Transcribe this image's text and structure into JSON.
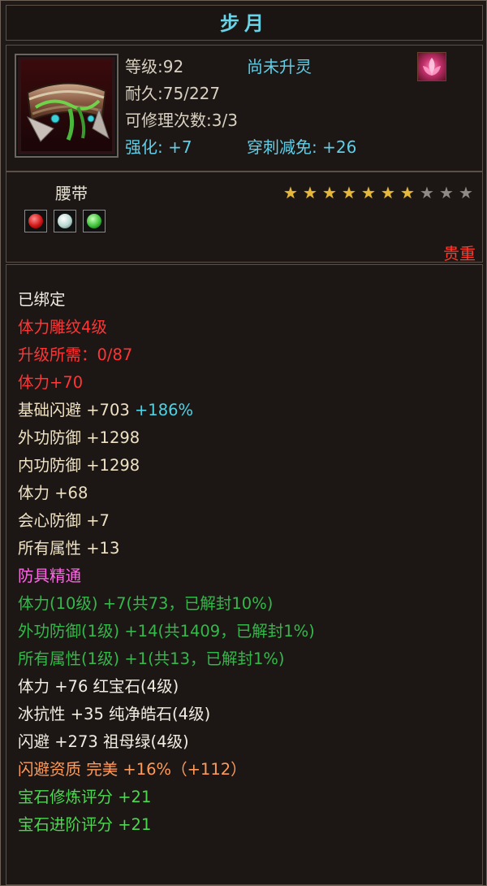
{
  "title": "步月",
  "header": {
    "level_label": "等级:",
    "level": "92",
    "spirit_status": "尚未升灵",
    "durability_label": "耐久:",
    "durability": "75/227",
    "repair_label": "可修理次数:",
    "repair": "3/3",
    "enhance": "强化: +7",
    "pierce_reduction": "穿刺减免: +26",
    "badge_icon": "lotus-icon",
    "item_icon": "belt-icon"
  },
  "info": {
    "type": "腰带",
    "stars_total": 10,
    "stars_filled": 7,
    "gem_icons": [
      "ruby-gem-icon",
      "pearl-gem-icon",
      "emerald-gem-icon"
    ],
    "rarity": "贵重"
  },
  "attributes": [
    {
      "segments": [
        {
          "text": "已绑定",
          "color": "white"
        }
      ]
    },
    {
      "segments": [
        {
          "text": "体力雕纹4级",
          "color": "red"
        }
      ]
    },
    {
      "segments": [
        {
          "text": "升级所需：0/87",
          "color": "red"
        }
      ]
    },
    {
      "segments": [
        {
          "text": "体力+70",
          "color": "red"
        }
      ]
    },
    {
      "segments": [
        {
          "text": "基础闪避 +703 ",
          "color": "cream"
        },
        {
          "text": "+186%",
          "color": "c-cyan"
        }
      ]
    },
    {
      "segments": [
        {
          "text": "外功防御 +1298",
          "color": "cream"
        }
      ]
    },
    {
      "segments": [
        {
          "text": "内功防御 +1298",
          "color": "cream"
        }
      ]
    },
    {
      "segments": [
        {
          "text": "体力 +68",
          "color": "cream"
        }
      ]
    },
    {
      "segments": [
        {
          "text": "会心防御 +7",
          "color": "cream"
        }
      ]
    },
    {
      "segments": [
        {
          "text": "所有属性 +13",
          "color": "cream"
        }
      ]
    },
    {
      "segments": [
        {
          "text": "防具精通",
          "color": "pink"
        }
      ]
    },
    {
      "segments": [
        {
          "text": "体力(10级) +7(共73，已解封10%)",
          "color": "green"
        }
      ]
    },
    {
      "segments": [
        {
          "text": "外功防御(1级) +14(共1409，已解封1%)",
          "color": "green"
        }
      ]
    },
    {
      "segments": [
        {
          "text": "所有属性(1级) +1(共13，已解封1%)",
          "color": "green"
        }
      ]
    },
    {
      "segments": [
        {
          "text": "体力 +76 红宝石(4级)",
          "color": "white"
        }
      ]
    },
    {
      "segments": [
        {
          "text": "冰抗性 +35 纯净皓石(4级)",
          "color": "white"
        }
      ]
    },
    {
      "segments": [
        {
          "text": "闪避 +273 祖母绿(4级)",
          "color": "white"
        }
      ]
    },
    {
      "segments": [
        {
          "text": "闪避资质  完美 +16%（+112）",
          "color": "orange"
        }
      ]
    },
    {
      "segments": [
        {
          "text": "宝石修炼评分 +21",
          "color": "bgreen"
        }
      ]
    },
    {
      "segments": [
        {
          "text": "宝石进阶评分 +21",
          "color": "bgreen"
        }
      ]
    }
  ]
}
